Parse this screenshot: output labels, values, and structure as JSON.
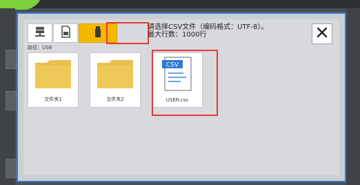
{
  "dialog": {
    "info_line1": "请选择CSV文件（编码格式：UTF-8）。",
    "info_line2": "最大行数：1000行",
    "path": "路径：USB",
    "close_symbol": "✕"
  },
  "toolbar": {
    "buttons": [
      {
        "icon": "network-drive-icon"
      },
      {
        "icon": "sd-card-icon"
      },
      {
        "icon": "usb-icon",
        "active": true
      }
    ]
  },
  "files": [
    {
      "type": "folder",
      "label": "文件夹1"
    },
    {
      "type": "folder",
      "label": "文件夹2"
    },
    {
      "type": "csv",
      "label": "USER.csv",
      "badge": "CSV",
      "selected": true
    }
  ],
  "colors": {
    "accent_border": "#2f7bd6",
    "usb_active": "#f5b800",
    "highlight": "#e53939",
    "folder": "#e9c04e"
  }
}
